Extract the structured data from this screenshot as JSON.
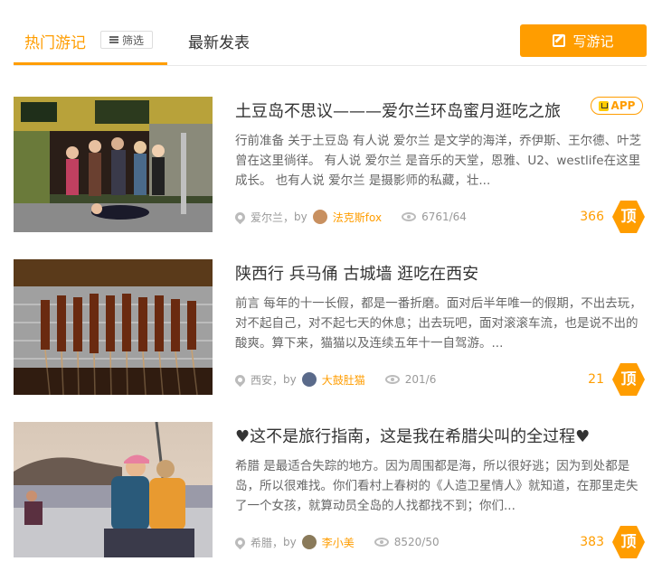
{
  "tabs": {
    "hot_label": "热门游记",
    "filter_label": "筛选",
    "new_label": "最新发表",
    "write_label": "写游记"
  },
  "articles": [
    {
      "title": "土豆岛不思议———爱尔兰环岛蜜月逛吃之旅",
      "badge": "APP",
      "excerpt": "行前准备 关于土豆岛 有人说 爱尔兰 是文学的海洋，乔伊斯、王尔德、叶芝曾在这里徜徉。 有人说 爱尔兰 是音乐的天堂，恩雅、U2、westlife在这里成长。 也有人说 爱尔兰 是摄影师的私藏，壮...",
      "location": "爱尔兰",
      "by": "by",
      "author": "法克斯fox",
      "stats": "6761/64",
      "votes": "366",
      "vote_label": "顶"
    },
    {
      "title": "陕西行 兵马俑 古城墙 逛吃在西安",
      "excerpt": "前言 每年的十一长假，都是一番折磨。面对后半年唯一的假期，不出去玩，对不起自己，对不起七天的休息；出去玩吧，面对滚滚车流，也是说不出的酸爽。算下来，猫猫以及连续五年十一自驾游。...",
      "location": "西安",
      "by": "by",
      "author": "大鼓肚猫",
      "stats": "201/6",
      "votes": "21",
      "vote_label": "顶"
    },
    {
      "title": "♥这不是旅行指南，这是我在希腊尖叫的全过程♥",
      "excerpt": "希腊 是最适合失踪的地方。因为周围都是海，所以很好逃；因为到处都是岛，所以很难找。你们看村上春树的《人造卫星情人》就知道，在那里走失了一个女孩，就算动员全岛的人找都找不到；你们...",
      "location": "希腊",
      "by": "by",
      "author": "李小美",
      "stats": "8520/50",
      "votes": "383",
      "vote_label": "顶"
    }
  ],
  "colors": {
    "accent": "#ff9d00",
    "text": "#333333",
    "muted": "#999999"
  }
}
